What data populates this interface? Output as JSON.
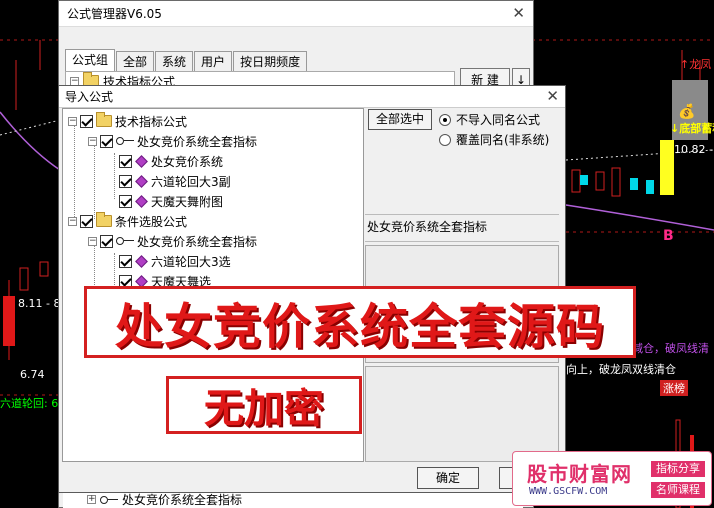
{
  "background_chart": {
    "price_labels": [
      {
        "text": "8.11 - 8.",
        "color": "#ffffff"
      },
      {
        "text": "6.74",
        "color": "#ffffff"
      },
      {
        "text": "六道轮回: 6.",
        "color": "#00ff00"
      },
      {
        "text": "10.82 -",
        "color": "#ffffff"
      },
      {
        "text": "B",
        "color": "#ff2a8a"
      },
      {
        "text": "↑龙凤",
        "color": "#ff3333"
      },
      {
        "text": "↓底部蓄积",
        "color": "#ffff00"
      }
    ],
    "signal_texts": [
      "向上，破龙线减仓，破凤线清",
      "向上，破龙凤双线清仓"
    ],
    "limit_up_label": "涨榜"
  },
  "formula_manager": {
    "title": "公式管理器V6.05",
    "tabs": [
      "公式组",
      "全部",
      "系统",
      "用户",
      "按日期频度"
    ],
    "tree_root_label": "技术指标公式",
    "new_button_label": "新 建",
    "arrow_button_label": "↓",
    "bottom_item_label": "处女竞价系统全套指标"
  },
  "import_dialog": {
    "title": "导入公式",
    "tree": [
      {
        "label": "技术指标公式",
        "checked": true
      },
      {
        "label": "处女竞价系统全套指标",
        "checked": true
      },
      {
        "label": "处女竞价系统",
        "checked": true
      },
      {
        "label": "六道轮回大3副",
        "checked": true
      },
      {
        "label": "天魔天舞附图",
        "checked": true
      },
      {
        "label": "条件选股公式",
        "checked": true
      },
      {
        "label": "处女竞价系统全套指标",
        "checked": true
      },
      {
        "label": "六道轮回大3选",
        "checked": true
      },
      {
        "label": "天魔天舞选",
        "checked": true
      }
    ],
    "select_all_label": "全部选中",
    "options": [
      {
        "label": "不导入同名公式",
        "selected": true
      },
      {
        "label": "覆盖同名(非系统)",
        "selected": false
      }
    ],
    "description_label": "处女竞价系统全套指标",
    "ok_label": "确定"
  },
  "overlay": {
    "headline": "处女竞价系统全套源码",
    "subline": "无加密"
  },
  "watermark": {
    "name": "股市财富网",
    "url": "WWW.GSCFW.COM",
    "tag1": "指标分享",
    "tag2": "名师课程"
  },
  "colors": {
    "accent_red": "#e01818",
    "dialog_bg": "#f0f0f0",
    "watermark_pink": "#e0306a"
  }
}
